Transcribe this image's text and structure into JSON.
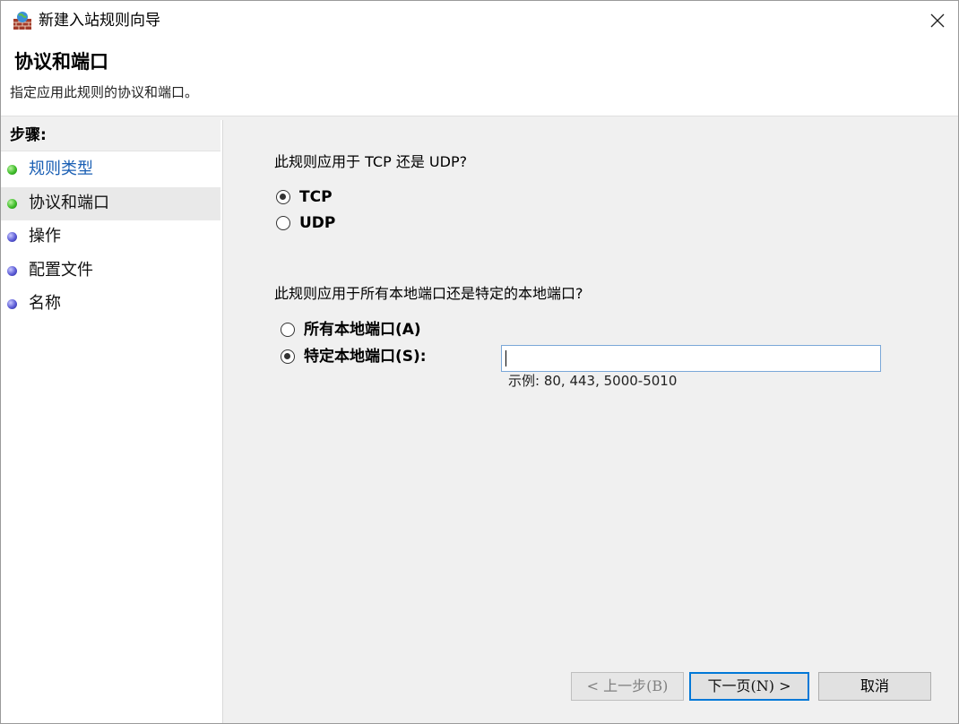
{
  "window": {
    "title": "新建入站规则向导"
  },
  "header": {
    "title": "协议和端口",
    "subtitle": "指定应用此规则的协议和端口。"
  },
  "steps": {
    "heading": "步骤:",
    "items": [
      {
        "label": "规则类型",
        "status": "done"
      },
      {
        "label": "协议和端口",
        "status": "current"
      },
      {
        "label": "操作",
        "status": "pending"
      },
      {
        "label": "配置文件",
        "status": "pending"
      },
      {
        "label": "名称",
        "status": "pending"
      }
    ]
  },
  "protocol": {
    "question": "此规则应用于 TCP 还是 UDP?",
    "options": [
      {
        "label": "TCP",
        "checked": true
      },
      {
        "label": "UDP",
        "checked": false
      }
    ]
  },
  "ports": {
    "question": "此规则应用于所有本地端口还是特定的本地端口?",
    "options": [
      {
        "label": "所有本地端口(A)",
        "checked": false
      },
      {
        "label": "特定本地端口(S):",
        "checked": true
      }
    ],
    "input_value": "",
    "example": "示例: 80, 443, 5000-5010"
  },
  "buttons": {
    "back": "< 上一步(B)",
    "next": "下一页(N) >",
    "cancel": "取消"
  },
  "colors": {
    "done_dot": "#3fbd2a",
    "pending_dot": "#5b5bd6",
    "link": "#1a5fb4",
    "focus": "#0078d7"
  }
}
